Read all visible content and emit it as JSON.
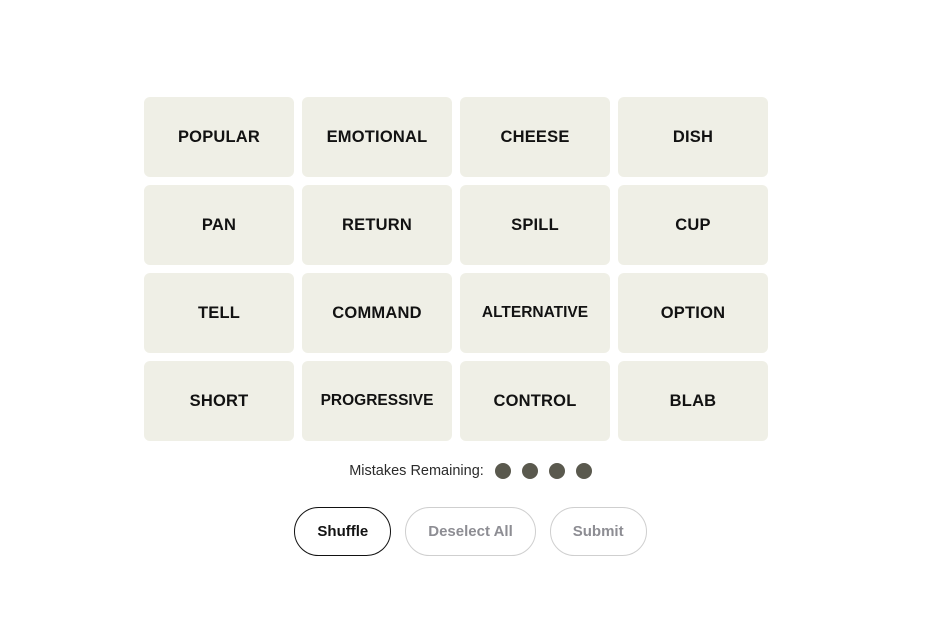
{
  "board": {
    "tiles": [
      {
        "word": "POPULAR"
      },
      {
        "word": "EMOTIONAL"
      },
      {
        "word": "CHEESE"
      },
      {
        "word": "DISH"
      },
      {
        "word": "PAN"
      },
      {
        "word": "RETURN"
      },
      {
        "word": "SPILL"
      },
      {
        "word": "CUP"
      },
      {
        "word": "TELL"
      },
      {
        "word": "COMMAND"
      },
      {
        "word": "ALTERNATIVE"
      },
      {
        "word": "OPTION"
      },
      {
        "word": "SHORT"
      },
      {
        "word": "PROGRESSIVE"
      },
      {
        "word": "CONTROL"
      },
      {
        "word": "BLAB"
      }
    ],
    "tile_bg_color": "#EFEFE6",
    "tile_text_color": "#121212"
  },
  "mistakes": {
    "label": "Mistakes Remaining:",
    "remaining": 4,
    "dot_color": "#5A594E"
  },
  "controls": {
    "shuffle_label": "Shuffle",
    "deselect_label": "Deselect All",
    "submit_label": "Submit",
    "enabled_border_color": "#121212",
    "disabled_border_color": "#CFCFCF",
    "disabled_text_color": "#8D8D93"
  }
}
